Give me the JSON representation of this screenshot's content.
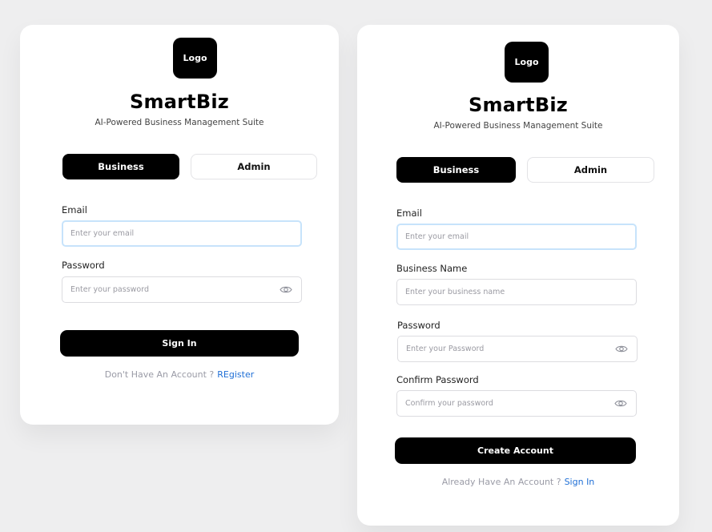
{
  "login": {
    "logo_text": "Logo",
    "app_name": "SmartBiz",
    "tagline": "AI-Powered Business Management Suite",
    "tabs": [
      {
        "label": "Business",
        "active": true
      },
      {
        "label": "Admin",
        "active": false
      }
    ],
    "email": {
      "label": "Email",
      "placeholder": "Enter your email",
      "value": ""
    },
    "password": {
      "label": "Password",
      "placeholder": "Enter your password",
      "value": ""
    },
    "submit_label": "Sign In",
    "footer_text": "Don't Have An Account ?",
    "footer_link": "REgister"
  },
  "register": {
    "logo_text": "Logo",
    "app_name": "SmartBiz",
    "tagline": "AI-Powered Business Management Suite",
    "tabs": [
      {
        "label": "Business",
        "active": true
      },
      {
        "label": "Admin",
        "active": false
      }
    ],
    "email": {
      "label": "Email",
      "placeholder": "Enter your email",
      "value": ""
    },
    "business_name": {
      "label": "Business Name",
      "placeholder": "Enter your business name",
      "value": ""
    },
    "password": {
      "label": "Password",
      "placeholder": "Enter your Password",
      "value": ""
    },
    "confirm_password": {
      "label": "Confirm Password",
      "placeholder": "Confirm your password",
      "value": ""
    },
    "submit_label": "Create Account",
    "footer_text": "Already Have An Account ?",
    "footer_link": "Sign In"
  },
  "icons": {
    "eye": "eye-icon"
  },
  "colors": {
    "background": "#eeeeef",
    "primary": "#000000",
    "link": "#1f6fd6",
    "focus_border": "#c7e3fb"
  }
}
